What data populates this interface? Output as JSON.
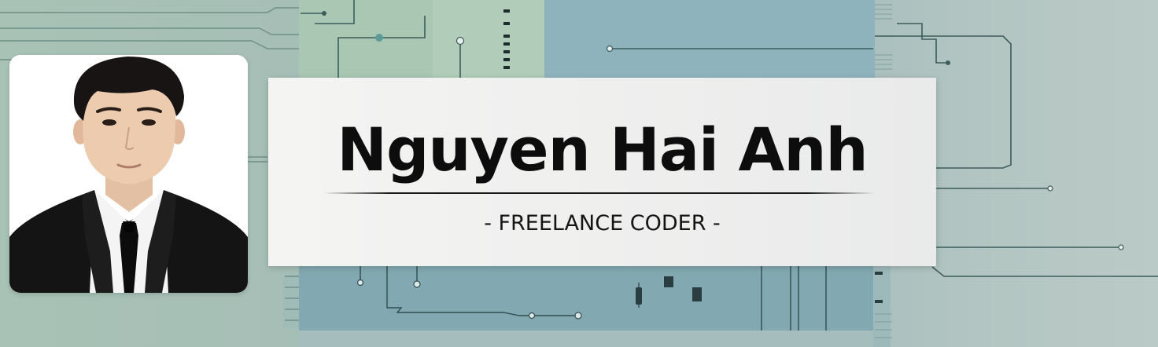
{
  "profile": {
    "name": "Nguyen Hai Anh",
    "role": "- FREELANCE CODER -"
  },
  "icons": {
    "photo": "portrait-photo",
    "circuit": "circuit-board-background"
  },
  "colors": {
    "background_green": "#a8c2b5",
    "background_teal": "#8fb1b6",
    "card": "#f0f0ef",
    "text": "#0d0d0d",
    "suit": "#151515"
  }
}
